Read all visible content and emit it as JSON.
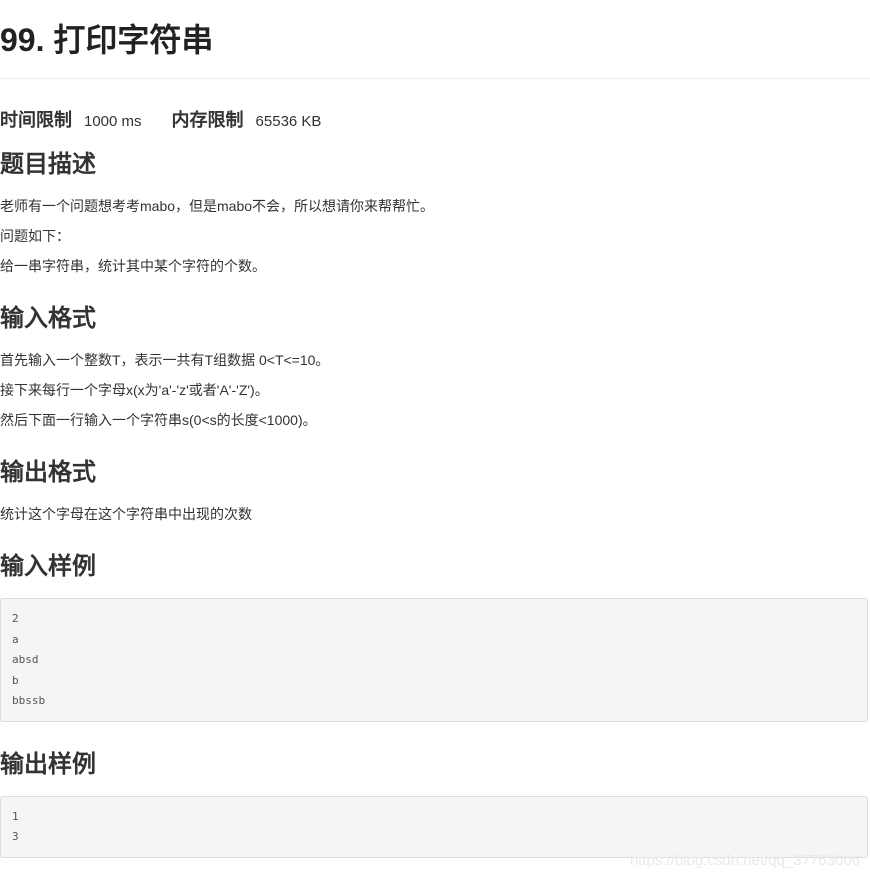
{
  "problem": {
    "title": "99. 打印字符串"
  },
  "limits": {
    "time_label": "时间限制",
    "time_value": "1000 ms",
    "memory_label": "内存限制",
    "memory_value": "65536 KB"
  },
  "description": {
    "heading": "题目描述",
    "lines": [
      "老师有一个问题想考考mabo，但是mabo不会，所以想请你来帮帮忙。",
      "问题如下：",
      "给一串字符串，统计其中某个字符的个数。"
    ]
  },
  "input_format": {
    "heading": "输入格式",
    "lines": [
      "首先输入一个整数T，表示一共有T组数据 0<T<=10。",
      "接下来每行一个字母x(x为'a'-'z'或者'A'-'Z')。",
      "然后下面一行输入一个字符串s(0<s的长度<1000)。"
    ]
  },
  "output_format": {
    "heading": "输出格式",
    "lines": [
      "统计这个字母在这个字符串中出现的次数"
    ]
  },
  "sample_input": {
    "heading": "输入样例",
    "lines": [
      "2",
      "a",
      "absd",
      "b",
      "bbssb"
    ]
  },
  "sample_output": {
    "heading": "输出样例",
    "lines": [
      "1",
      "3"
    ]
  },
  "watermark": "https://blog.csdn.net/qq_37763006"
}
